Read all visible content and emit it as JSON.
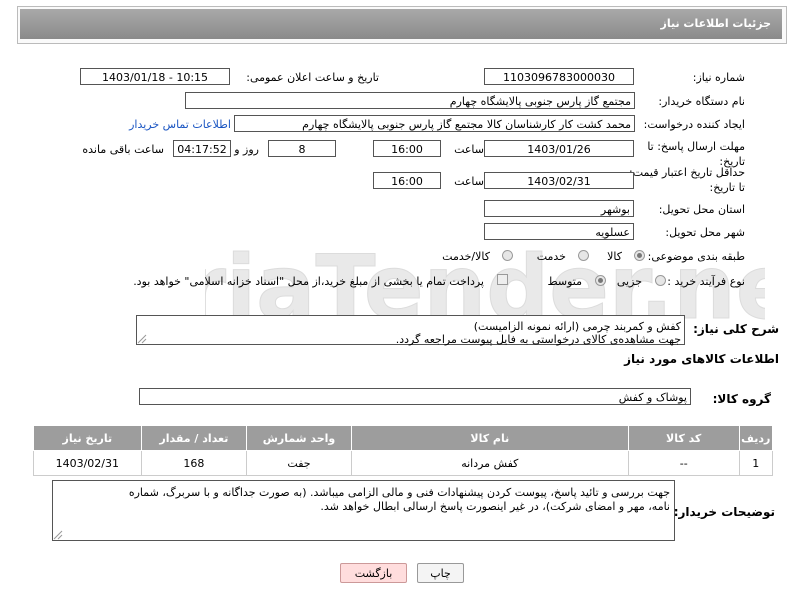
{
  "page_title": "جزئیات اطلاعات نیاز",
  "fields": {
    "need_number_label": "شماره نیاز:",
    "need_number": "1103096783000030",
    "announce_label": "تاریخ و ساعت اعلان عمومی:",
    "announce_value": "1403/01/18 - 10:15",
    "buyer_org_label": "نام دستگاه خریدار:",
    "buyer_org": "مجتمع گاز پارس جنوبی  پالایشگاه چهارم",
    "requester_label": "ایجاد کننده درخواست:",
    "requester": "محمد کشت کار کارشناسان کالا مجتمع گاز پارس جنوبی  پالایشگاه چهارم",
    "buyer_contact_link": "اطلاعات تماس خریدار",
    "deadline_label": "مهلت ارسال پاسخ: تا تاریخ:",
    "deadline_date": "1403/01/26",
    "time_label": "ساعت",
    "deadline_time": "16:00",
    "days_value": "8",
    "days_label": "روز و",
    "remaining_time": "04:17:52",
    "remaining_label": "ساعت باقی مانده",
    "validity_label": "حداقل تاریخ اعتبار قیمت: تا تاریخ:",
    "validity_date": "1403/02/31",
    "validity_time": "16:00",
    "province_label": "استان محل تحویل:",
    "province": "بوشهر",
    "city_label": "شهر محل تحویل:",
    "city": "عسلویه",
    "category_label": "طبقه بندی موضوعی:",
    "category_options": [
      "کالا",
      "خدمت",
      "کالا/خدمت"
    ],
    "process_label": "نوع فرآیند خرید :",
    "process_options": [
      "جزیی",
      "متوسط"
    ],
    "process_note": "پرداخت تمام یا بخشی از مبلغ خرید،از محل \"اسناد خزانه اسلامی\" خواهد بود."
  },
  "description": {
    "label": "شرح کلی نیاز:",
    "line1": "کفش و کمربند چرمی (ارائه نمونه الزامیست)",
    "line2": "جهت مشاهده‌ی کالای درخواستی به فایل پیوست مراجعه گردد."
  },
  "goods_section_title": "اطلاعات کالاهای مورد نیاز",
  "goods_group_label": "گروه کالا:",
  "goods_group": "پوشاک و کفش",
  "table": {
    "headers": [
      "ردیف",
      "کد کالا",
      "نام کالا",
      "واحد شمارش",
      "تعداد / مقدار",
      "تاریخ نیاز"
    ],
    "rows": [
      [
        "1",
        "--",
        "کفش مردانه",
        "جفت",
        "168",
        "1403/02/31"
      ]
    ]
  },
  "buyer_notes": {
    "label": "توضیحات خریدار:",
    "line1": "جهت بررسی و تائید پاسخ، پیوست کردن پیشنهادات فنی و مالی الزامی میباشد. (به صورت جداگانه و با سربرگ، شماره",
    "line2": "نامه، مهر و امضای شرکت)، در غیر اینصورت پاسخ ارسالی ابطال خواهد شد."
  },
  "buttons": {
    "print": "چاپ",
    "back": "بازگشت"
  },
  "colors": {
    "header_bg": "#999999",
    "link": "#1a55c2",
    "back_button_bg": "#fdd"
  }
}
